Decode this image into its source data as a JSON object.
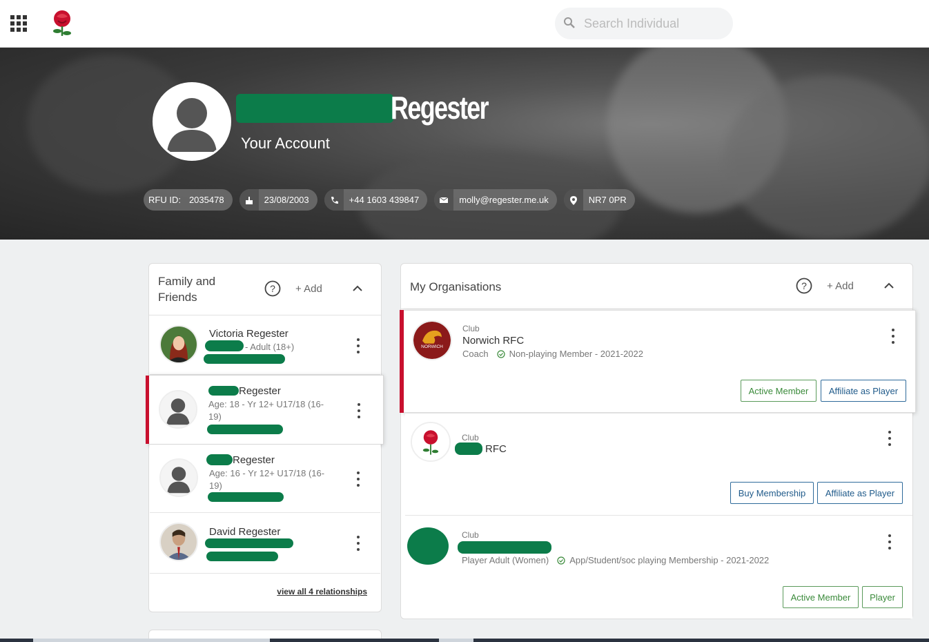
{
  "header": {
    "search_placeholder": "Search Individual",
    "apps_icon": "apps-grid-icon",
    "logo_icon": "rose-logo"
  },
  "profile": {
    "surname": "Regester",
    "subtitle": "Your Account",
    "chips": {
      "rfu_label": "RFU ID:",
      "rfu_id": "2035478",
      "dob": "23/08/2003",
      "phone": "+44 1603 439847",
      "email": "molly@regester.me.uk",
      "postcode": "NR7 0PR"
    }
  },
  "family": {
    "title": "Family and Friends",
    "add_label": "+ Add",
    "members": [
      {
        "name": "Victoria Regester",
        "detail": "- Adult (18+)"
      },
      {
        "name": "Regester",
        "detail": "Age: 18 - Yr 12+ U17/18 (16-19)"
      },
      {
        "name": "Regester",
        "detail": "Age: 16 - Yr 12+ U17/18 (16-19)"
      },
      {
        "name": "David Regester",
        "detail": ""
      }
    ],
    "view_all": "view all 4 relationships"
  },
  "orgs": {
    "title": "My Organisations",
    "add_label": "+ Add",
    "items": [
      {
        "type": "Club",
        "name": "Norwich RFC",
        "role": "Coach",
        "membership": "Non-playing Member - 2021-2022",
        "buttons": [
          "Active Member",
          "Affiliate as Player"
        ]
      },
      {
        "type": "Club",
        "name": "RFC",
        "buttons": [
          "Buy Membership",
          "Affiliate as Player"
        ]
      },
      {
        "type": "Club",
        "role": "Player Adult (Women)",
        "membership": "App/Student/soc playing Membership - 2021-2022",
        "buttons": [
          "Active Member",
          "Player"
        ]
      }
    ]
  },
  "colors": {
    "accent_red": "#c8102e",
    "redaction_green": "#0c7c4a",
    "button_green": "#3a8a3a",
    "button_blue": "#1f5a8a"
  }
}
